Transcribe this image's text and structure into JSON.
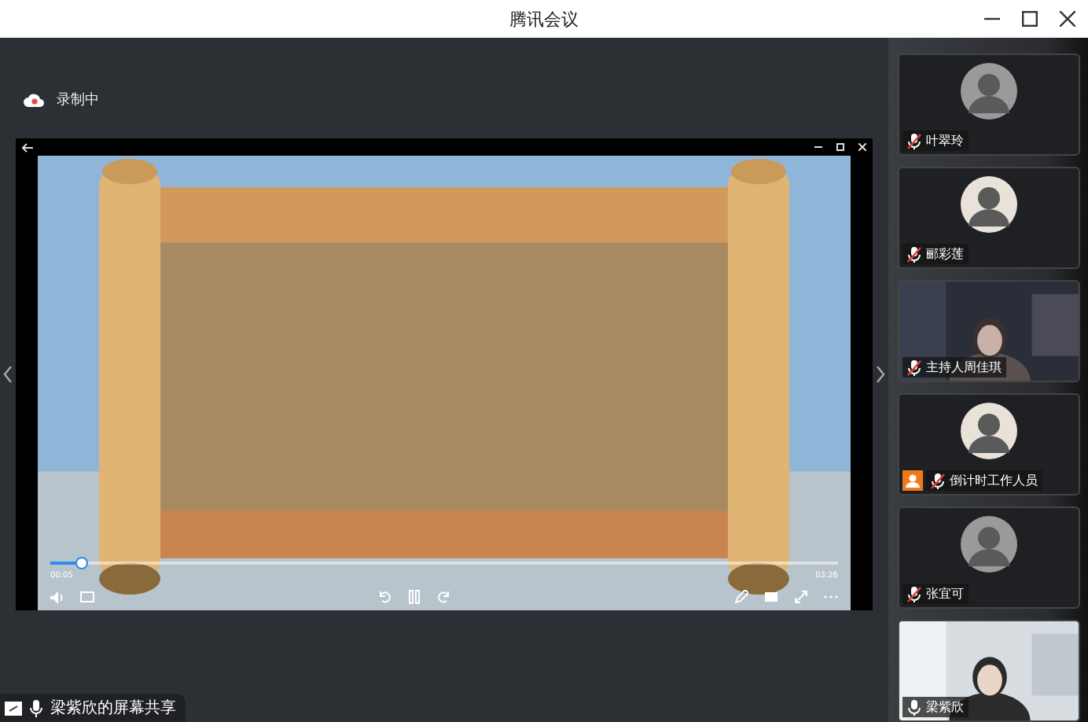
{
  "window": {
    "title": "腾讯会议"
  },
  "recording": {
    "label": "录制中"
  },
  "player": {
    "progress": {
      "level": 0.04
    },
    "elapsed": "00:05",
    "duration": "03:26",
    "playing": true
  },
  "share_label": "梁紫欣的屏幕共享",
  "participants": [
    {
      "name": "叶翠玲",
      "kind": "avatar",
      "muted": true,
      "host": false
    },
    {
      "name": "郦彩莲",
      "kind": "avatar",
      "muted": true,
      "host": false
    },
    {
      "name": "主持人周佳琪",
      "kind": "video",
      "muted": true,
      "host": false
    },
    {
      "name": "倒计时工作人员",
      "kind": "avatar",
      "muted": true,
      "host": true
    },
    {
      "name": "张宜可",
      "kind": "avatar",
      "muted": true,
      "host": false
    },
    {
      "name": "梁紫欣",
      "kind": "video",
      "muted": false,
      "host": false
    }
  ]
}
